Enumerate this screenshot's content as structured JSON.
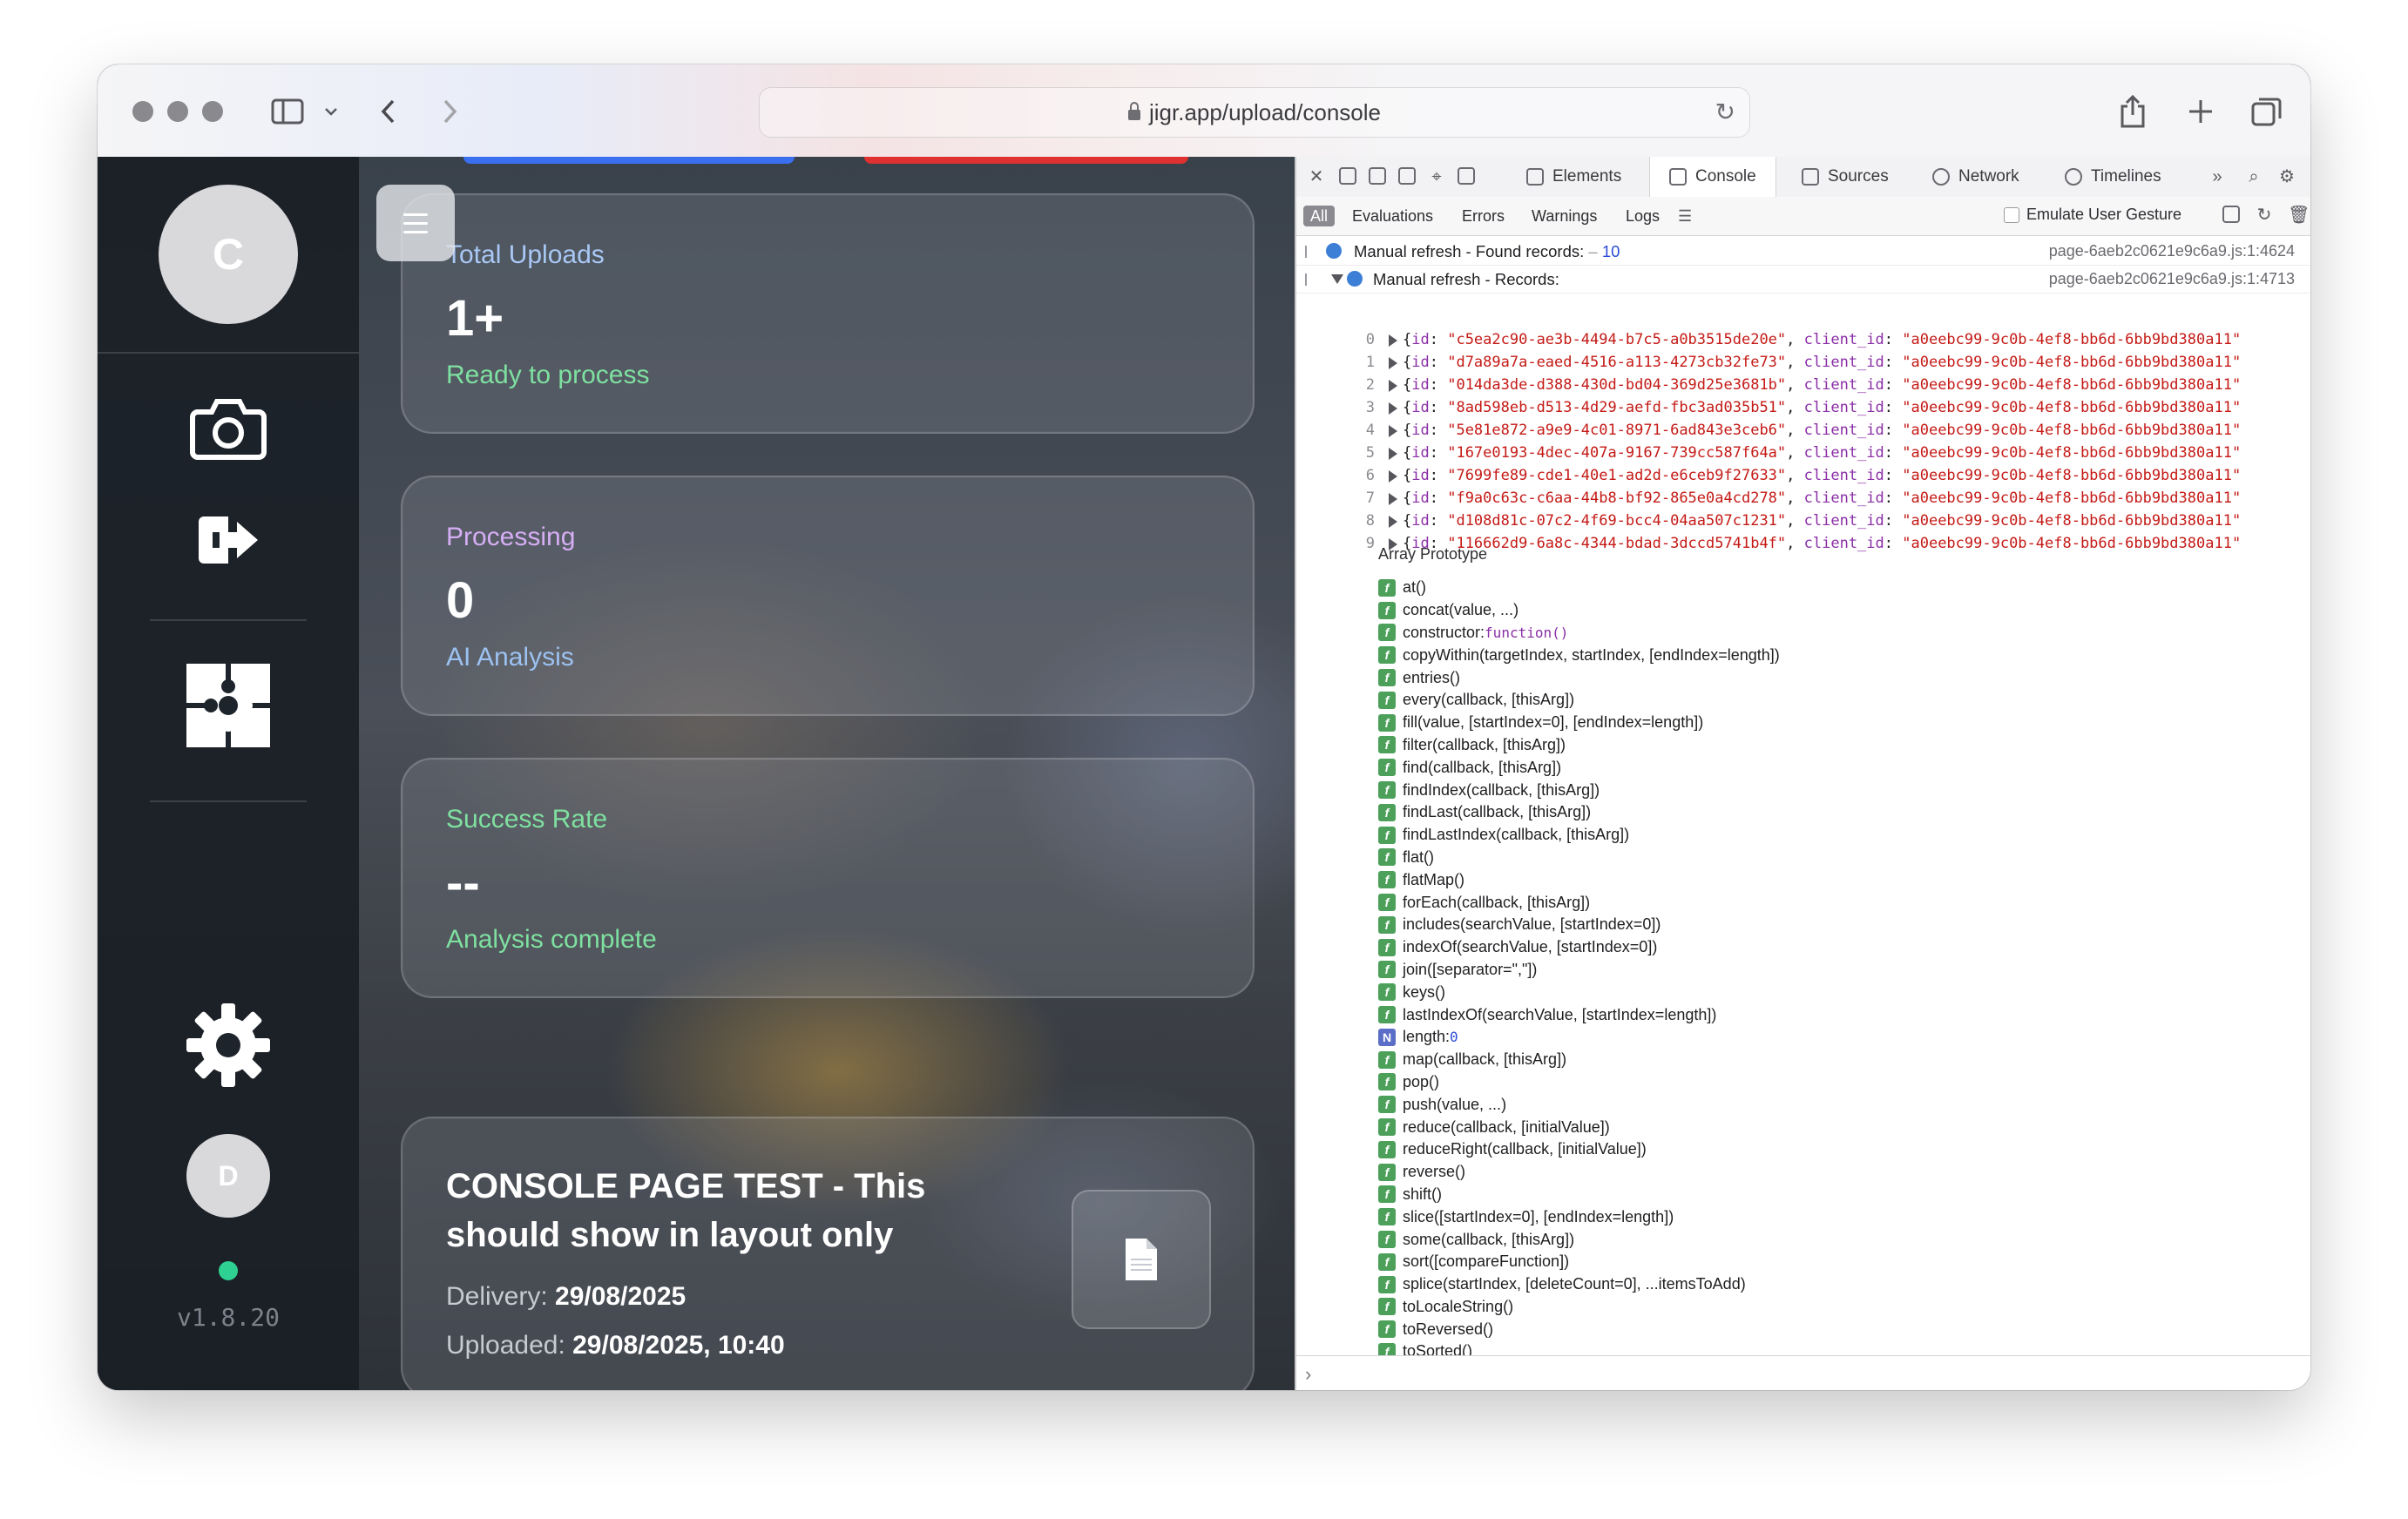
{
  "browser": {
    "url": "jigr.app/upload/console"
  },
  "sidebar": {
    "top_avatar_initial": "C",
    "bottom_avatar_initial": "D",
    "version": "v1.8.20",
    "status_color": "#2fd192"
  },
  "stats": {
    "total": {
      "label": "Total Uploads",
      "value": "1+",
      "sub": "Ready to process",
      "label_color": "#a9c8f5",
      "sub_color": "#7ee0a0"
    },
    "processing": {
      "label": "Processing",
      "value": "0",
      "sub": "AI Analysis",
      "label_color": "#d6aef5",
      "sub_color": "#9cc2f2"
    },
    "success": {
      "label": "Success Rate",
      "value": "--",
      "sub": "Analysis complete",
      "label_color": "#7ee0a0",
      "sub_color": "#7ee0a0"
    }
  },
  "upload": {
    "title": "CONSOLE PAGE TEST - This should show in layout only",
    "delivery_label": "Delivery:",
    "delivery_value": "29/08/2025",
    "uploaded_label": "Uploaded:",
    "uploaded_value": "29/08/2025, 10:40"
  },
  "devtools": {
    "tabs": [
      "Elements",
      "Console",
      "Sources",
      "Network",
      "Timelines"
    ],
    "active_tab": "Console",
    "filters": [
      "All",
      "Evaluations",
      "Errors",
      "Warnings",
      "Logs"
    ],
    "emulate_label": "Emulate User Gesture",
    "messages": [
      {
        "text": "Manual refresh - Found records:",
        "count_sep": " – ",
        "count": "10",
        "source": "page-6aeb2c0621e9c6a9.js:1:4624"
      },
      {
        "text": "Manual refresh - Records:",
        "source": "page-6aeb2c0621e9c6a9.js:1:4713"
      }
    ],
    "client_id": "\"a0eebc99-9c0b-4ef8-bb6d-6bb9bd380a11\"",
    "records": [
      {
        "index": "0",
        "id": "\"c5ea2c90-ae3b-4494-b7c5-a0b3515de20e\""
      },
      {
        "index": "1",
        "id": "\"d7a89a7a-eaed-4516-a113-4273cb32fe73\""
      },
      {
        "index": "2",
        "id": "\"014da3de-d388-430d-bd04-369d25e3681b\""
      },
      {
        "index": "3",
        "id": "\"8ad598eb-d513-4d29-aefd-fbc3ad035b51\""
      },
      {
        "index": "4",
        "id": "\"5e81e872-a9e9-4c01-8971-6ad843e3ceb6\""
      },
      {
        "index": "5",
        "id": "\"167e0193-4dec-407a-9167-739cc587f64a\""
      },
      {
        "index": "6",
        "id": "\"7699fe89-cde1-40e1-ad2d-e6ceb9f27633\""
      },
      {
        "index": "7",
        "id": "\"f9a0c63c-c6aa-44b8-bf92-865e0a4cd278\""
      },
      {
        "index": "8",
        "id": "\"d108d81c-07c2-4f69-bcc4-04aa507c1231\""
      },
      {
        "index": "9",
        "id": "\"116662d9-6a8c-4344-bdad-3dccd5741b4f\""
      }
    ],
    "prototype_title": "Array Prototype",
    "prototype": [
      {
        "icon": "f",
        "text": "at()"
      },
      {
        "icon": "f",
        "text": "concat(value, ...)"
      },
      {
        "icon": "f",
        "text": "constructor: ",
        "kw": "function()"
      },
      {
        "icon": "f",
        "text": "copyWithin(targetIndex, startIndex, [endIndex=length])"
      },
      {
        "icon": "f",
        "text": "entries()"
      },
      {
        "icon": "f",
        "text": "every(callback, [thisArg])"
      },
      {
        "icon": "f",
        "text": "fill(value, [startIndex=0], [endIndex=length])"
      },
      {
        "icon": "f",
        "text": "filter(callback, [thisArg])"
      },
      {
        "icon": "f",
        "text": "find(callback, [thisArg])"
      },
      {
        "icon": "f",
        "text": "findIndex(callback, [thisArg])"
      },
      {
        "icon": "f",
        "text": "findLast(callback, [thisArg])"
      },
      {
        "icon": "f",
        "text": "findLastIndex(callback, [thisArg])"
      },
      {
        "icon": "f",
        "text": "flat()"
      },
      {
        "icon": "f",
        "text": "flatMap()"
      },
      {
        "icon": "f",
        "text": "forEach(callback, [thisArg])"
      },
      {
        "icon": "f",
        "text": "includes(searchValue, [startIndex=0])"
      },
      {
        "icon": "f",
        "text": "indexOf(searchValue, [startIndex=0])"
      },
      {
        "icon": "f",
        "text": "join([separator=\",\"])"
      },
      {
        "icon": "f",
        "text": "keys()"
      },
      {
        "icon": "f",
        "text": "lastIndexOf(searchValue, [startIndex=length])"
      },
      {
        "icon": "N",
        "text": "length: ",
        "num": "0"
      },
      {
        "icon": "f",
        "text": "map(callback, [thisArg])"
      },
      {
        "icon": "f",
        "text": "pop()"
      },
      {
        "icon": "f",
        "text": "push(value, ...)"
      },
      {
        "icon": "f",
        "text": "reduce(callback, [initialValue])"
      },
      {
        "icon": "f",
        "text": "reduceRight(callback, [initialValue])"
      },
      {
        "icon": "f",
        "text": "reverse()"
      },
      {
        "icon": "f",
        "text": "shift()"
      },
      {
        "icon": "f",
        "text": "slice([startIndex=0], [endIndex=length])"
      },
      {
        "icon": "f",
        "text": "some(callback, [thisArg])"
      },
      {
        "icon": "f",
        "text": "sort([compareFunction])"
      },
      {
        "icon": "f",
        "text": "splice(startIndex, [deleteCount=0], ...itemsToAdd)"
      },
      {
        "icon": "f",
        "text": "toLocaleString()"
      },
      {
        "icon": "f",
        "text": "toReversed()"
      },
      {
        "icon": "f",
        "text": "toSorted()"
      }
    ]
  }
}
